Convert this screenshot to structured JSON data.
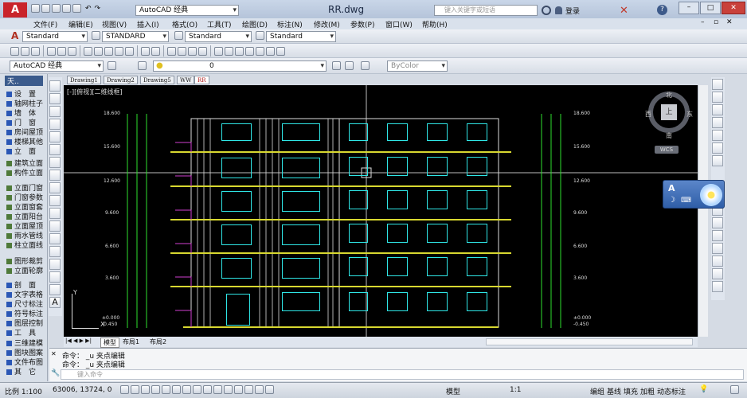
{
  "title": {
    "filename": "RR.dwg",
    "workspace": "AutoCAD 经典",
    "search_placeholder": "键入关键字或短语",
    "login": "登录"
  },
  "menu": [
    "文件(F)",
    "编辑(E)",
    "视图(V)",
    "插入(I)",
    "格式(O)",
    "工具(T)",
    "绘图(D)",
    "标注(N)",
    "修改(M)",
    "参数(P)",
    "窗口(W)",
    "帮助(H)"
  ],
  "styles": {
    "text": "Standard",
    "dim": "STANDARD",
    "table": "Standard",
    "multileader": "Standard"
  },
  "layers": {
    "workspace": "AutoCAD 经典",
    "layer": "0",
    "color": "ByColor"
  },
  "file_tabs": [
    "Drawing1",
    "Drawing2",
    "Drawing5",
    "WW",
    "RR"
  ],
  "viewport_label": "[-][俯视][二维线框]",
  "left_panel": {
    "title": "天..",
    "items": [
      "设　置",
      "轴网柱子",
      "墙　体",
      "门　窗",
      "房间屋顶",
      "楼梯其他",
      "立　面",
      "建筑立面",
      "构件立面",
      "立面门窗",
      "门窗参数",
      "立面窗套",
      "立面阳台",
      "立面屋顶",
      "雨水管线",
      "柱立面线",
      "图形裁剪",
      "立面轮廓",
      "剖　面",
      "文字表格",
      "尺寸标注",
      "符号标注",
      "图层控制",
      "工　具",
      "三维建模",
      "图块图案",
      "文件布图",
      "其　它"
    ]
  },
  "compass": {
    "n": "北",
    "s": "南",
    "e": "东",
    "w": "西",
    "top": "上",
    "wcs": "WCS"
  },
  "levels_left": [
    "18.600",
    "15.600",
    "12.600",
    "9.600",
    "6.600",
    "3.600",
    "±0.000",
    "-0.450"
  ],
  "levels_right": [
    "18.600",
    "15.600",
    "12.600",
    "9.600",
    "6.600",
    "3.600",
    "±0.000",
    "-0.450"
  ],
  "layout_tabs": [
    "模型",
    "布局1",
    "布局2"
  ],
  "command": {
    "line1": "命令： _u 夹点编辑",
    "line2": "命令： _u 夹点编辑",
    "prompt": "键入命令"
  },
  "status": {
    "scale": "比例 1:100",
    "coords": "63006, 13724, 0",
    "model": "模型",
    "anno_scale": "1:1",
    "items": [
      "编组",
      "基线",
      "填充",
      "加粗",
      "动态标注"
    ]
  },
  "ime": {
    "mode": "A"
  }
}
